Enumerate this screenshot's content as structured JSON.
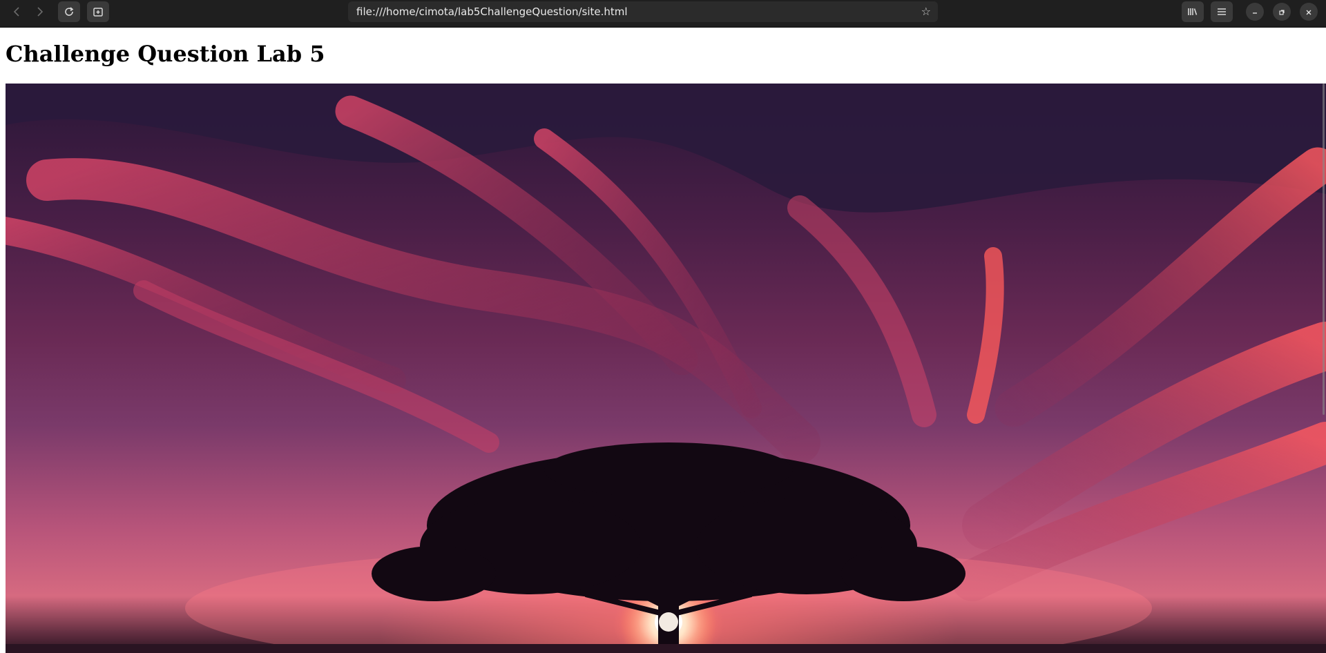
{
  "browser": {
    "address_url": "file:///home/cimota/lab5ChallengeQuestion/site.html",
    "icons": {
      "back": "back-arrow-icon",
      "forward": "forward-arrow-icon",
      "reload": "reload-icon",
      "new_tab": "new-tab-icon",
      "bookmark": "star-icon",
      "library": "library-icon",
      "menu": "hamburger-menu-icon",
      "minimize": "minimize-icon",
      "restore": "restore-icon",
      "close": "close-icon"
    }
  },
  "page": {
    "title": "Challenge Question Lab 5",
    "hero_image": "sunset-tree-photo"
  },
  "colors": {
    "toolbar_bg": "#1f1f1f",
    "urlbar_bg": "#2b2b2b",
    "page_bg": "#ffffff",
    "sky_top": "#2a1738",
    "sky_glow": "#d66a80"
  }
}
